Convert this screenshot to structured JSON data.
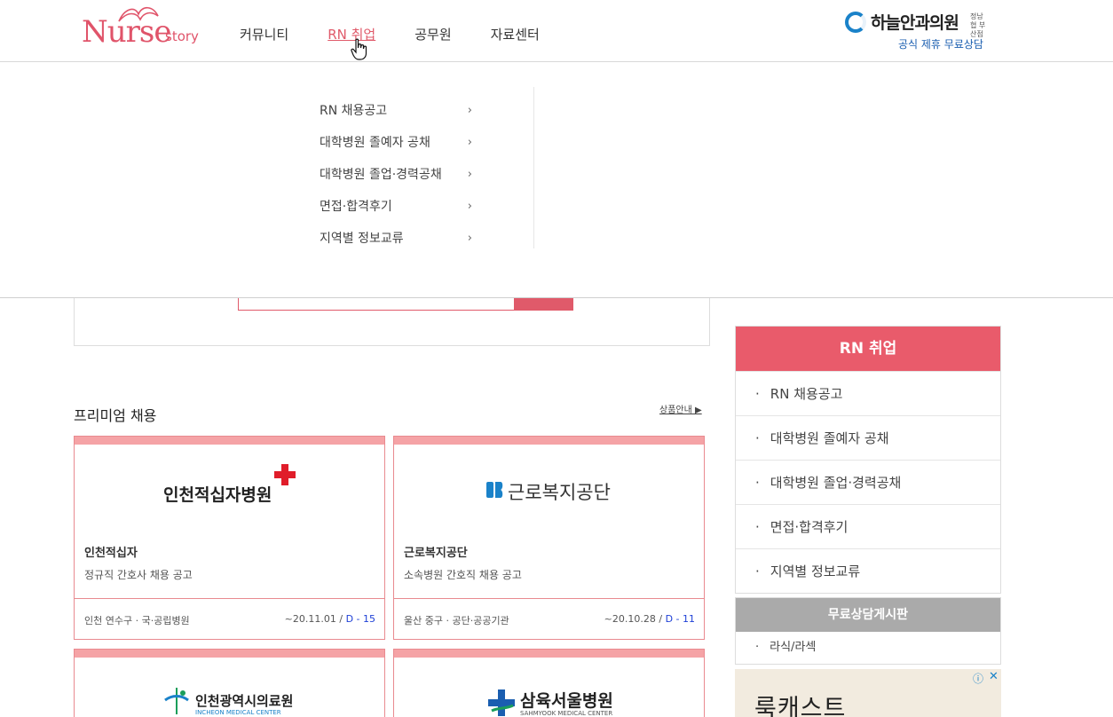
{
  "header": {
    "logo": {
      "main": "Nurse",
      "sub": "story"
    },
    "nav": [
      "커뮤니티",
      "RN 취업",
      "공무원",
      "자료센터"
    ],
    "active_nav": "RN 취업",
    "ad": {
      "name": "하늘안과의원",
      "small": "정남협 부산점",
      "sub": "공식 제휴 무료상담"
    }
  },
  "dropdown": {
    "items": [
      "RN 채용공고",
      "대학병원 졸예자 공채",
      "대학병원 졸업·경력공채",
      "면접·합격후기",
      "지역별 정보교류"
    ],
    "chevron": "›"
  },
  "premium": {
    "title": "프리미엄 채용",
    "link": "상품안내 ▶",
    "cards": [
      {
        "logo_text": "인천적십자병원",
        "name": "인천적십자",
        "desc": "정규직 간호사 채용 공고",
        "location": "인천 연수구 · 국·공립병원",
        "date": "~20.11.01 / ",
        "dday": "D - 15"
      },
      {
        "logo_text": "근로복지공단",
        "name": "근로복지공단",
        "desc": "소속병원 간호직 채용 공고",
        "location": "울산 중구 · 공단·공공기관",
        "date": "~20.10.28 / ",
        "dday": "D - 11"
      },
      {
        "logo_text": "인천광역시의료원",
        "logo_sub": "INCHEON MEDICAL CENTER"
      },
      {
        "logo_text": "삼육서울병원",
        "logo_sub": "SAHMYOOK MEDICAL CENTER"
      }
    ]
  },
  "sidebar": {
    "title": "RN 취업",
    "items": [
      "RN 채용공고",
      "대학병원 졸예자 공채",
      "대학병원 졸업·경력공채",
      "면접·합격후기",
      "지역별 정보교류"
    ],
    "bullet": "·",
    "consult": {
      "title": "무료상담게시판",
      "items": [
        "라식/라섹"
      ]
    }
  },
  "ad_bottom": {
    "text": "룩캐스트",
    "info_icon": "ⓘ",
    "close_icon": "✕"
  },
  "colors": {
    "accent": "#e95b6b",
    "card_bar": "#f5a3a6",
    "dday": "#1d3fd6"
  }
}
